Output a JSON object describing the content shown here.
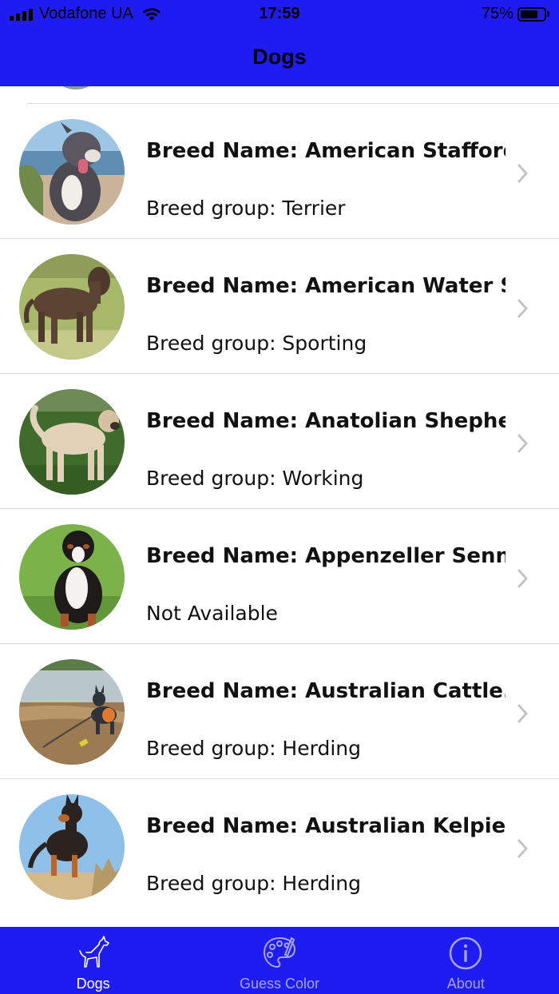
{
  "status_bar": {
    "carrier": "Vodafone UA",
    "time": "17:59",
    "battery_percent": "75%",
    "battery_level": 0.75
  },
  "nav": {
    "title": "Dogs"
  },
  "colors": {
    "bar_blue": "#1f1cf2",
    "tab_inactive": "#a3a6ea",
    "divider": "#d9d9dc",
    "chevron": "#c4c4c7"
  },
  "breeds": [
    {
      "name": "Breed Name: American Stafford...",
      "group": "Breed group: Terrier",
      "photo": "staffordshire-terrier-photo"
    },
    {
      "name": "Breed Name: American Water S...",
      "group": "Breed group: Sporting",
      "photo": "water-spaniel-photo"
    },
    {
      "name": "Breed Name: Anatolian Shephe...",
      "group": "Breed group: Working",
      "photo": "anatolian-shepherd-photo"
    },
    {
      "name": "Breed Name: Appenzeller Senn...",
      "group": "Not Available",
      "photo": "appenzeller-photo"
    },
    {
      "name": "Breed Name: Australian Cattle...",
      "group": "Breed group: Herding",
      "photo": "cattle-dog-photo"
    },
    {
      "name": "Breed Name: Australian Kelpie",
      "group": "Breed group: Herding",
      "photo": "kelpie-photo"
    }
  ],
  "tabs": [
    {
      "label": "Dogs",
      "icon": "dog-icon",
      "active": true
    },
    {
      "label": "Guess Color",
      "icon": "palette-icon",
      "active": false
    },
    {
      "label": "About",
      "icon": "info-icon",
      "active": false
    }
  ]
}
